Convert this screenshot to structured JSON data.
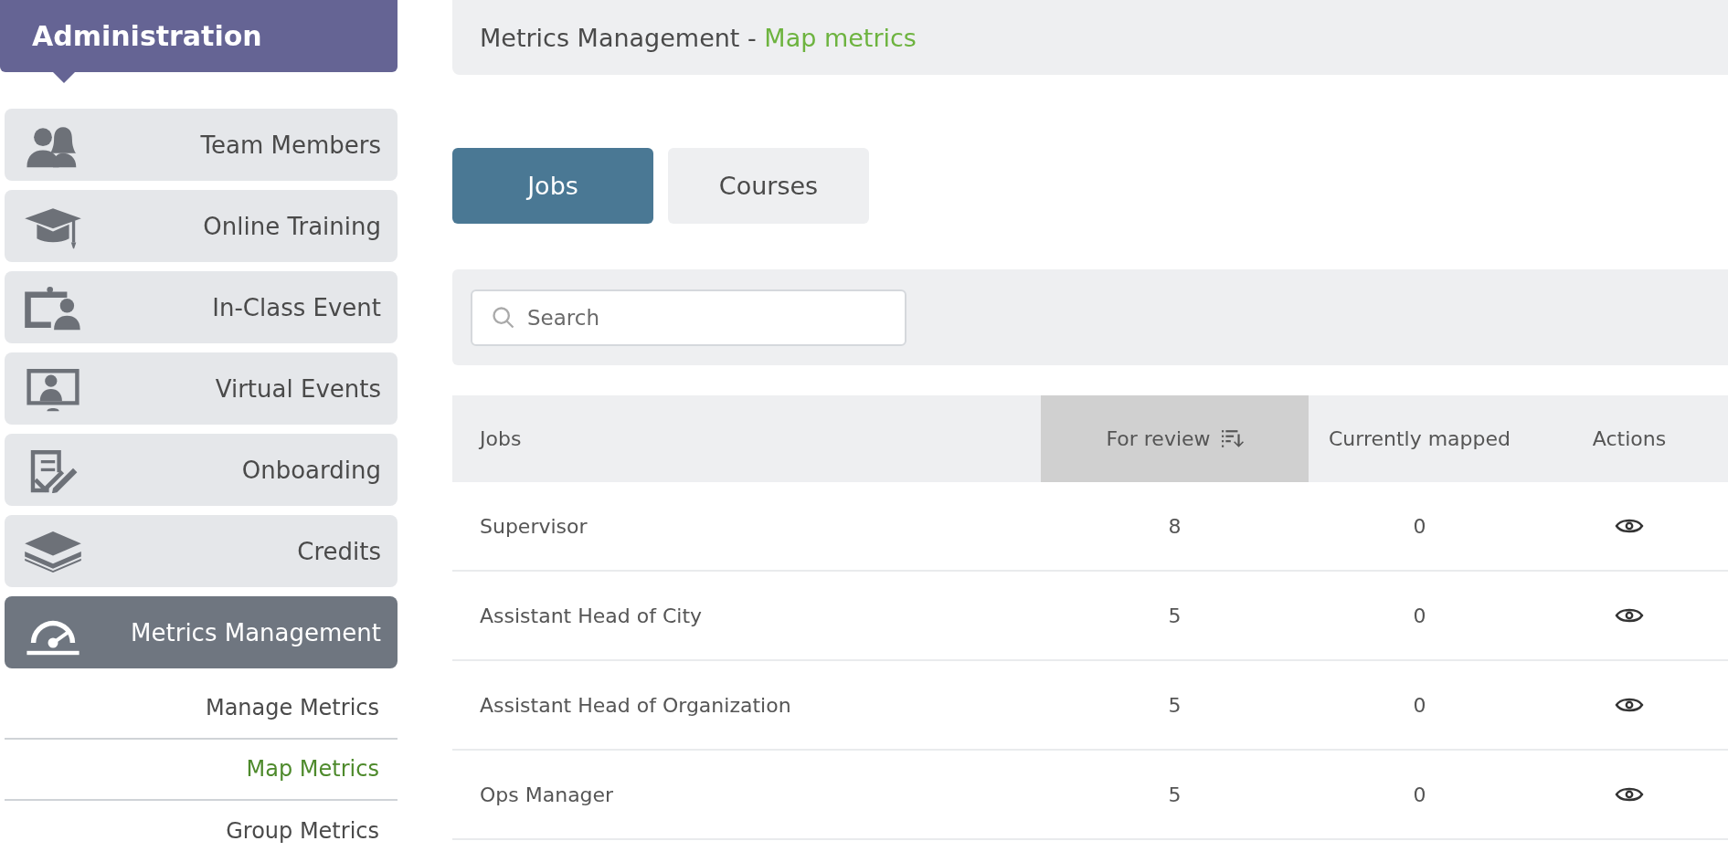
{
  "sidebar": {
    "title": "Administration",
    "items": [
      {
        "label": "Team Members",
        "kind": "people",
        "selected": false
      },
      {
        "label": "Online Training",
        "kind": "cap",
        "selected": false
      },
      {
        "label": "In-Class Event",
        "kind": "classroom",
        "selected": false
      },
      {
        "label": "Virtual Events",
        "kind": "screen",
        "selected": false
      },
      {
        "label": "Onboarding",
        "kind": "checklist",
        "selected": false
      },
      {
        "label": "Credits",
        "kind": "layers",
        "selected": false
      },
      {
        "label": "Metrics Management",
        "kind": "gauge",
        "selected": true
      }
    ],
    "subitems": [
      {
        "label": "Manage Metrics",
        "selected": false
      },
      {
        "label": "Map Metrics",
        "selected": true
      },
      {
        "label": "Group Metrics",
        "selected": false
      }
    ]
  },
  "breadcrumb": {
    "section": "Metrics Management - ",
    "page": "Map metrics"
  },
  "tabs": [
    {
      "label": "Jobs",
      "selected": true
    },
    {
      "label": "Courses",
      "selected": false
    }
  ],
  "search": {
    "placeholder": "Search"
  },
  "table": {
    "columns": [
      {
        "label": "Jobs",
        "sorted": false
      },
      {
        "label": "For review",
        "sorted": true
      },
      {
        "label": "Currently mapped",
        "sorted": false
      },
      {
        "label": "Actions",
        "sorted": false
      }
    ],
    "rows": [
      {
        "job": "Supervisor",
        "for_review": "8",
        "currently_mapped": "0"
      },
      {
        "job": "Assistant Head of City",
        "for_review": "5",
        "currently_mapped": "0"
      },
      {
        "job": "Assistant Head of Organization",
        "for_review": "5",
        "currently_mapped": "0"
      },
      {
        "job": "Ops Manager",
        "for_review": "5",
        "currently_mapped": "0"
      }
    ]
  }
}
